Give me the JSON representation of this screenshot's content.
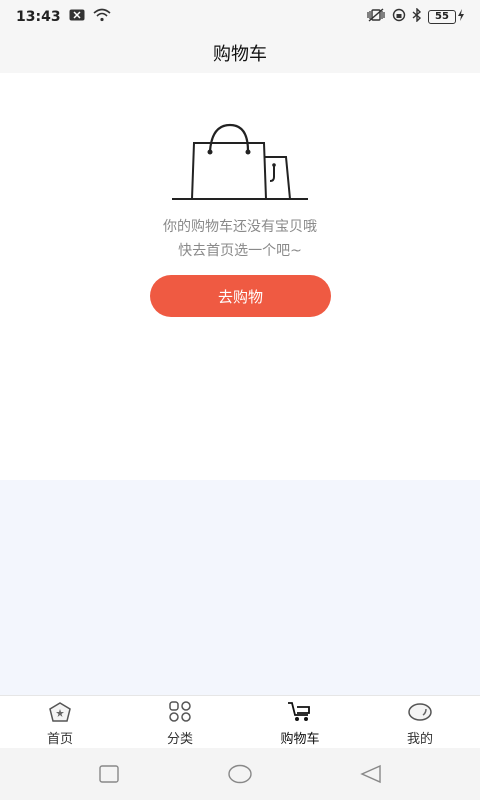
{
  "status": {
    "time": "13:43",
    "battery": "55"
  },
  "header": {
    "title": "购物车"
  },
  "empty_state": {
    "line1": "你的购物车还没有宝贝哦",
    "line2": "快去首页选一个吧~",
    "button_label": "去购物"
  },
  "colors": {
    "accent": "#ef5a42",
    "lower_background": "#f3f6fd"
  },
  "tabbar": {
    "items": [
      {
        "label": "首页",
        "icon": "home-icon"
      },
      {
        "label": "分类",
        "icon": "category-icon"
      },
      {
        "label": "购物车",
        "icon": "cart-icon",
        "active": true
      },
      {
        "label": "我的",
        "icon": "profile-icon"
      }
    ]
  },
  "system_nav": {
    "icons": [
      "recent-apps-icon",
      "home-circle-icon",
      "back-icon"
    ]
  }
}
